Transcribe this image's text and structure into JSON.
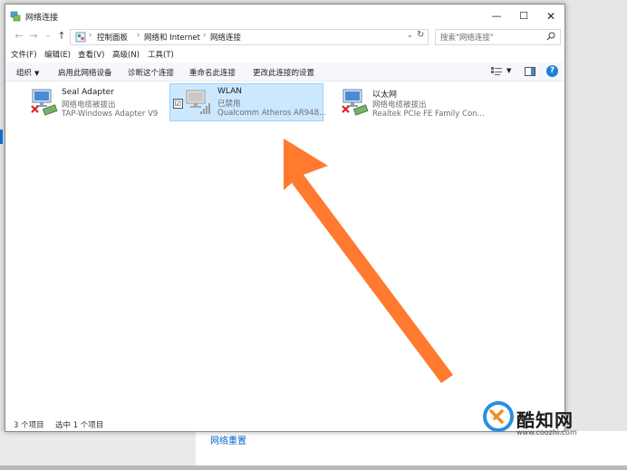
{
  "window": {
    "title": "网络连接",
    "controls": [
      "minimize-icon",
      "maximize-icon",
      "close-icon"
    ]
  },
  "nav": {
    "back": "←",
    "forward": "→",
    "recent": "⌄",
    "up": "↑"
  },
  "address": {
    "crumbs": [
      "控制面板",
      "网络和 Internet",
      "网络连接"
    ],
    "separator": "›",
    "dropdown": "⌄",
    "refresh": "↻"
  },
  "search": {
    "placeholder": "搜索\"网络连接\""
  },
  "menu": {
    "items": [
      "文件(F)",
      "编辑(E)",
      "查看(V)",
      "高级(N)",
      "工具(T)"
    ]
  },
  "commands": {
    "organize": "组织",
    "organize_caret": "▼",
    "items": [
      "启用此网络设备",
      "诊断这个连接",
      "重命名此连接",
      "更改此连接的设置"
    ],
    "view_caret": "▼",
    "help": "?"
  },
  "adapters": [
    {
      "name": "Seal Adapter",
      "status": "网络电缆被拔出",
      "device": "TAP-Windows Adapter V9",
      "selected": false,
      "disabled_mark": "red-x"
    },
    {
      "name": "WLAN",
      "status": "已禁用",
      "device": "Qualcomm Atheros AR948...",
      "selected": true,
      "checkbox": "☑"
    },
    {
      "name": "以太网",
      "status": "网络电缆被拔出",
      "device": "Realtek PCIe FE Family Con...",
      "selected": false,
      "disabled_mark": "red-x"
    }
  ],
  "status": {
    "count": "3 个项目",
    "selection": "选中 1 个项目"
  },
  "background": {
    "link": "网络重置"
  },
  "watermark": {
    "name": "酷知网",
    "url": "www.coozhi.com"
  },
  "colors": {
    "accent": "#0078d7",
    "selection": "#cce8ff",
    "arrow": "#ff7a2f",
    "error": "#e02020"
  }
}
